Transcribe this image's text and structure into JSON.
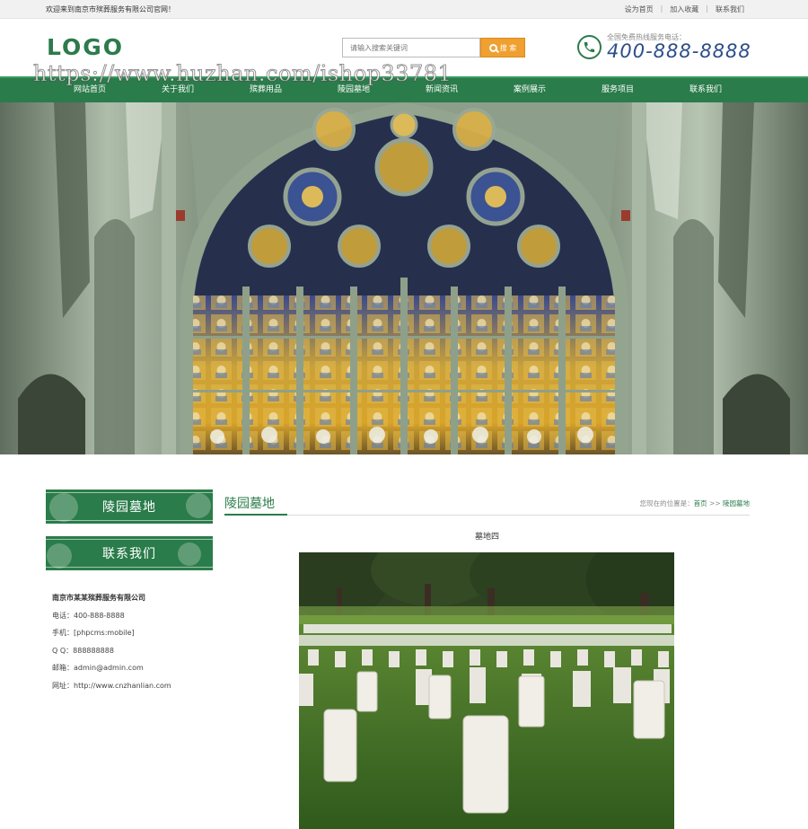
{
  "topbar": {
    "welcome": "欢迎来到南京市殡葬服务有限公司官网！",
    "links": [
      "设为首页",
      "加入收藏",
      "联系我们"
    ]
  },
  "header": {
    "logo": "LOGO",
    "search_placeholder": "请输入搜索关键词",
    "search_button": "搜 索",
    "hotline_label": "全国免费热线服务电话：",
    "hotline_number": "400-888-8888"
  },
  "nav": {
    "items": [
      "网站首页",
      "关于我们",
      "殡葬用品",
      "陵园墓地",
      "新闻资讯",
      "案例展示",
      "服务项目",
      "联系我们"
    ]
  },
  "watermark": "https://www.huzhan.com/ishop33781",
  "sidebar": {
    "category_title": "陵园墓地",
    "contact_title": "联系我们",
    "company": "南京市某某殡葬服务有限公司",
    "phone": "电话：400-888-8888",
    "mobile": "手机：[phpcms:mobile]",
    "qq": "Q Q：888888888",
    "email": "邮箱：admin@admin.com",
    "website": "网址：http://www.cnzhanlian.com"
  },
  "main": {
    "title": "陵园墓地",
    "breadcrumb_prefix": "您现在的位置是：",
    "breadcrumb_home": "首页",
    "breadcrumb_sep": " >> ",
    "breadcrumb_current": "陵园墓地",
    "article_title": "墓地四"
  },
  "colors": {
    "brand_green": "#2a7c4a",
    "search_orange": "#f0a030",
    "hotline_blue": "#2d4e8a"
  }
}
